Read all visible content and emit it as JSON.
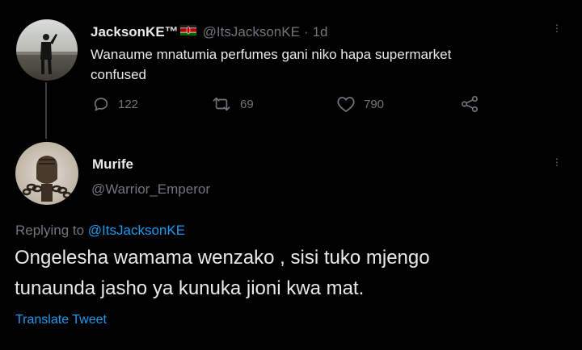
{
  "parent_tweet": {
    "display_name": "JacksonKE™",
    "handle": "@ItsJacksonKE",
    "separator": "·",
    "time": "1d",
    "text_line1": "Wanaume mnatumia perfumes gani niko hapa supermarket",
    "text_line2": "confused",
    "replies": "122",
    "retweets": "69",
    "likes": "790"
  },
  "reply_tweet": {
    "display_name": "Murife",
    "handle": "@Warrior_Emperor",
    "replying_prefix": "Replying to",
    "replying_to": "@ItsJacksonKE",
    "text_line1": "Ongelesha wamama wenzako , sisi tuko mjengo",
    "text_line2": "tunaunda jasho ya kunuka jioni kwa mat.",
    "translate": "Translate Tweet"
  },
  "icons": {
    "reply": "reply-icon",
    "retweet": "retweet-icon",
    "like": "heart-icon",
    "share": "share-icon",
    "more": "more-icon",
    "flag": "kenya-flag-icon"
  },
  "colors": {
    "background": "#000000",
    "text": "#e7e9ea",
    "muted": "#71767b",
    "link": "#1d9bf0"
  }
}
